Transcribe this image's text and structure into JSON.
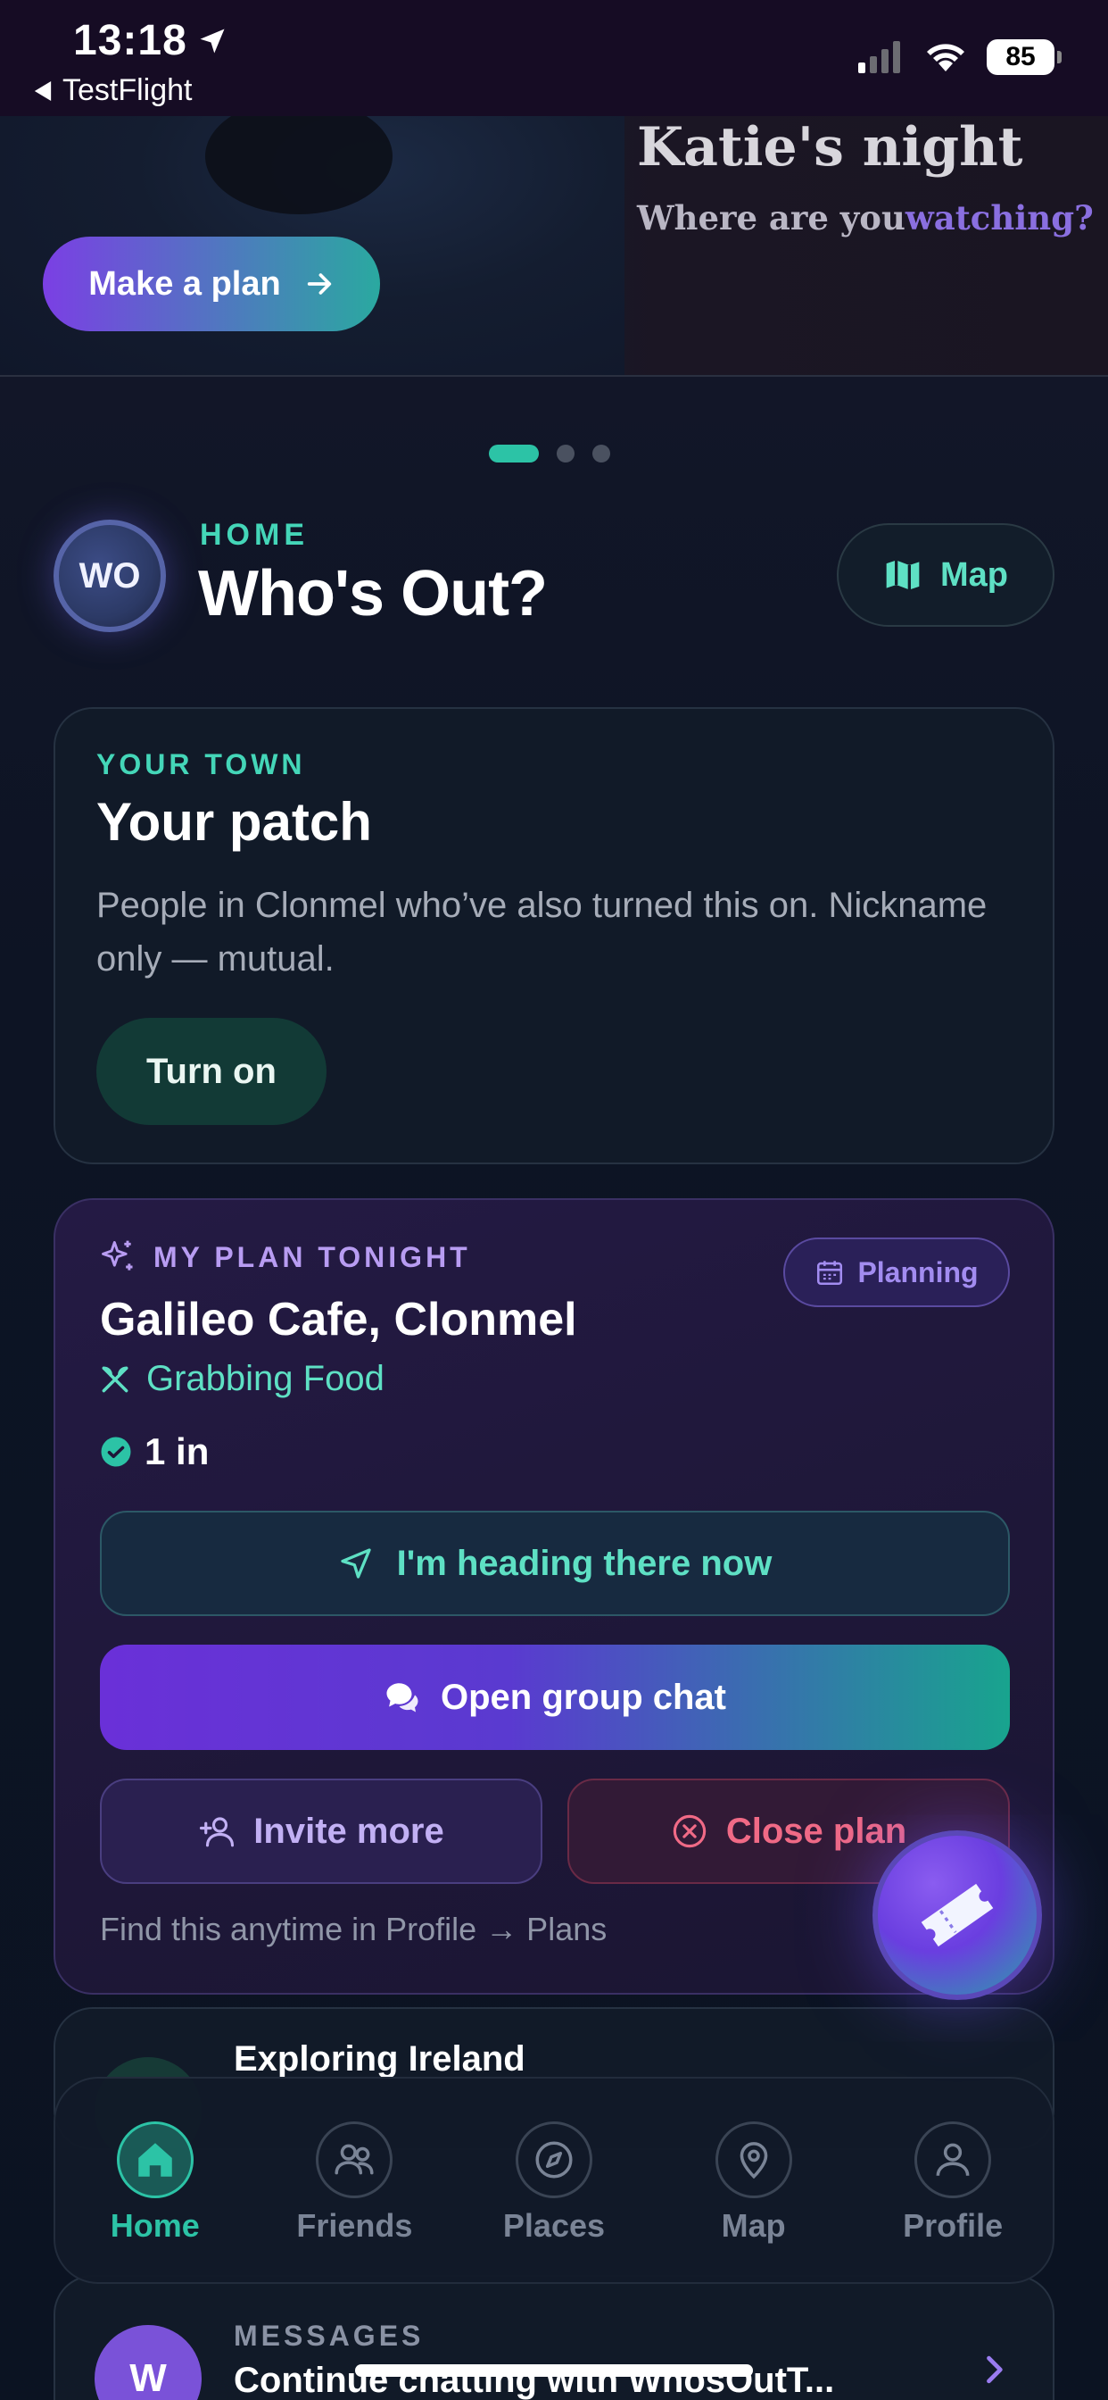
{
  "status_bar": {
    "time": "13:18",
    "back_app": "TestFlight",
    "battery": "85"
  },
  "hero": {
    "title": "Katie's night",
    "subtitle_prefix": "Where are you",
    "subtitle_highlight": "watching?",
    "cta_label": "Make a plan"
  },
  "carousel": {
    "pages": 3,
    "active": 0
  },
  "header": {
    "logo_text": "WO",
    "section_label": "HOME",
    "title": "Who's Out?",
    "map_button": "Map"
  },
  "town_card": {
    "eyebrow": "YOUR TOWN",
    "title": "Your patch",
    "description": "People in Clonmel who’ve also turned this on. Nickname only — mutual.",
    "button": "Turn on"
  },
  "plan_card": {
    "eyebrow": "MY PLAN TONIGHT",
    "status_badge": "Planning",
    "venue": "Galileo Cafe, Clonmel",
    "activity": "Grabbing Food",
    "attendance": "1 in",
    "heading_button": "I'm heading there now",
    "chat_button": "Open group chat",
    "invite_button": "Invite more",
    "close_button": "Close plan",
    "footer": "Find this anytime in Profile → Plans"
  },
  "peek_card": {
    "title": "Exploring Ireland"
  },
  "tabbar": {
    "items": [
      {
        "label": "Home",
        "icon": "home-icon",
        "active": true
      },
      {
        "label": "Friends",
        "icon": "friends-icon",
        "active": false
      },
      {
        "label": "Places",
        "icon": "compass-icon",
        "active": false
      },
      {
        "label": "Map",
        "icon": "map-pin-icon",
        "active": false
      },
      {
        "label": "Profile",
        "icon": "profile-icon",
        "active": false
      }
    ]
  },
  "messages_card": {
    "avatar_initial": "W",
    "eyebrow": "MESSAGES",
    "text": "Continue chatting with WhosOutT..."
  },
  "colors": {
    "accent_teal": "#2cc3a6",
    "accent_purple": "#7b3fe4",
    "danger": "#f06a86"
  }
}
